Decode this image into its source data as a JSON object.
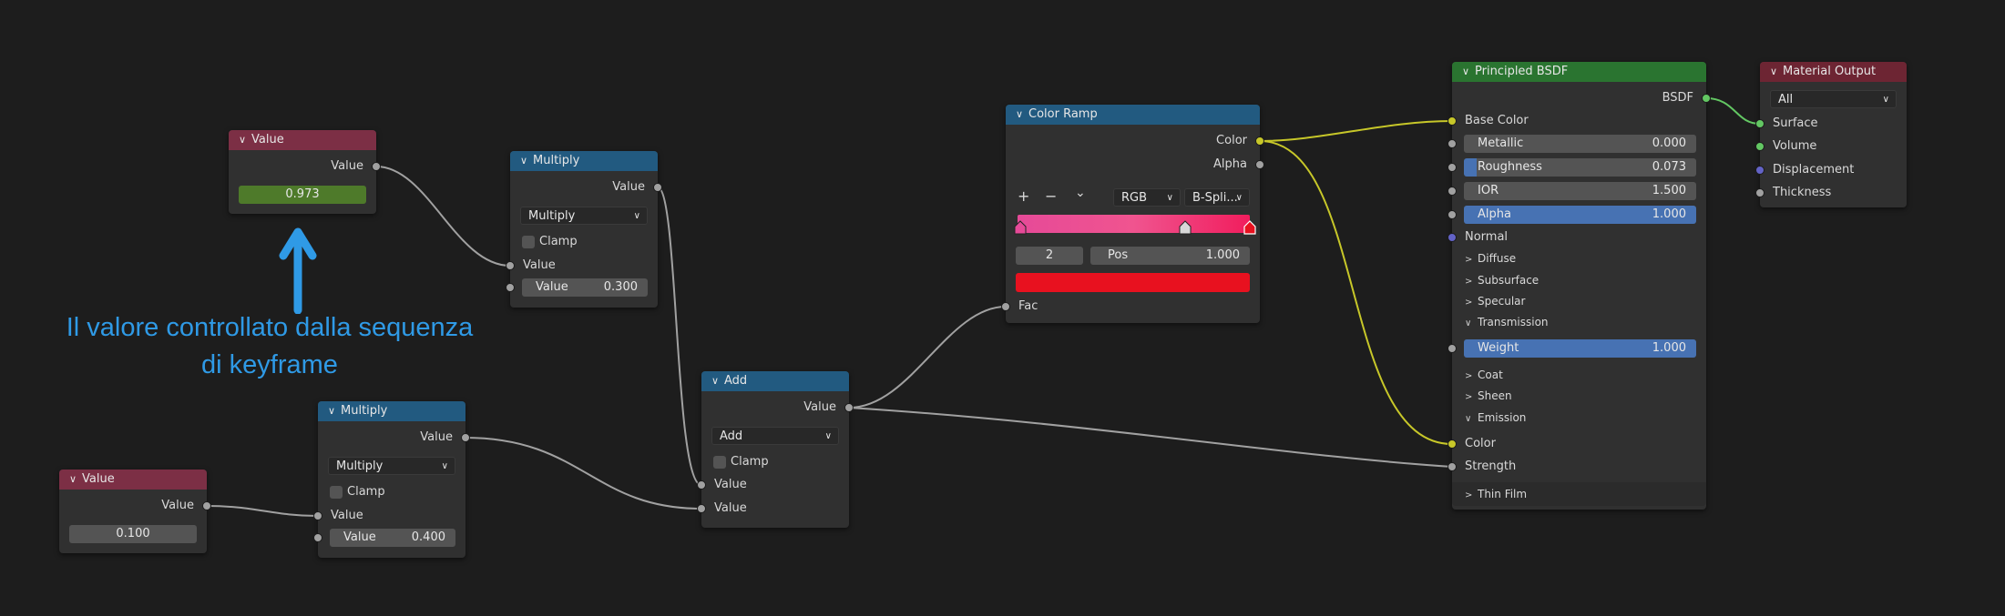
{
  "annotation": {
    "line1": "Il valore controllato dalla sequenza",
    "line2": "di keyframe"
  },
  "colors": {
    "annotation": "#2f9ae6",
    "input_header": "#7c2f45",
    "converter_header": "#225a80",
    "shader_header": "#2a7430",
    "output_header": "#6d2533",
    "wire_gray": "#a1a1a1",
    "wire_yellow": "#c7c729",
    "wire_green": "#63c763"
  },
  "nodes": {
    "value_top": {
      "title": "Value",
      "out_label": "Value",
      "value": "0.973"
    },
    "value_bottom": {
      "title": "Value",
      "out_label": "Value",
      "value": "0.100"
    },
    "multiply_top": {
      "title": "Multiply",
      "out_label": "Value",
      "operation": "Multiply",
      "clamp_label": "Clamp",
      "in_label": "Value",
      "field_label": "Value",
      "field_value": "0.300"
    },
    "multiply_bottom": {
      "title": "Multiply",
      "out_label": "Value",
      "operation": "Multiply",
      "clamp_label": "Clamp",
      "in_label": "Value",
      "field_label": "Value",
      "field_value": "0.400"
    },
    "add": {
      "title": "Add",
      "out_label": "Value",
      "operation": "Add",
      "clamp_label": "Clamp",
      "in1_label": "Value",
      "in2_label": "Value"
    },
    "color_ramp": {
      "title": "Color Ramp",
      "out_color": "Color",
      "out_alpha": "Alpha",
      "add_icon": "+",
      "remove_icon": "−",
      "menu_icon": "⌄",
      "color_mode": "RGB",
      "interpolation": "B-Spli...",
      "index": "2",
      "pos_label": "Pos",
      "pos_value": "1.000",
      "selected_color": "#e8111f",
      "ramp_colors": [
        "#e64a98",
        "#f0548f",
        "#f11d5d"
      ],
      "in_fac": "Fac"
    },
    "principled": {
      "title": "Principled BSDF",
      "out_label": "BSDF",
      "base_color": "Base Color",
      "metallic": {
        "label": "Metallic",
        "value": "0.000"
      },
      "roughness": {
        "label": "Roughness",
        "value": "0.073"
      },
      "ior": {
        "label": "IOR",
        "value": "1.500"
      },
      "alpha": {
        "label": "Alpha",
        "value": "1.000"
      },
      "normal": "Normal",
      "diffuse": "Diffuse",
      "subsurface": "Subsurface",
      "specular": "Specular",
      "transmission": "Transmission",
      "weight": {
        "label": "Weight",
        "value": "1.000"
      },
      "coat": "Coat",
      "sheen": "Sheen",
      "emission": "Emission",
      "emission_color": "Color",
      "emission_strength": "Strength",
      "thin_film": "Thin Film"
    },
    "material_output": {
      "title": "Material Output",
      "target": "All",
      "surface": "Surface",
      "volume": "Volume",
      "displacement": "Displacement",
      "thickness": "Thickness"
    }
  }
}
